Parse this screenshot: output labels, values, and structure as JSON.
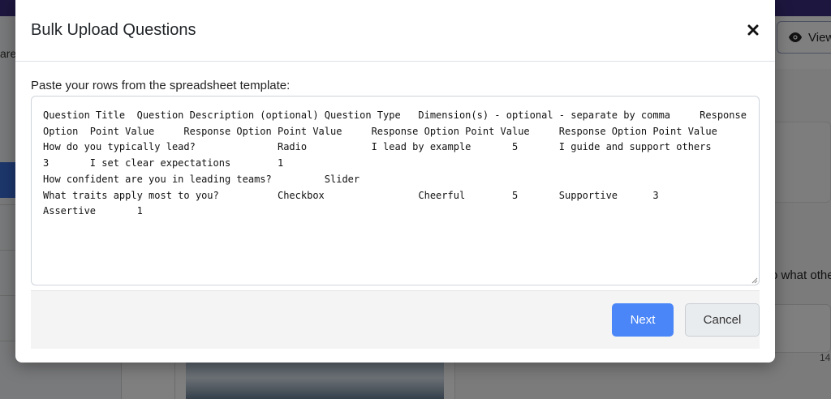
{
  "background": {
    "left_partial_text": "are",
    "view_button_label": "View",
    "right_partial_text": "o what othe",
    "right_partial_number": "14"
  },
  "modal": {
    "title": "Bulk Upload Questions",
    "close_icon": "close-icon",
    "field_label": "Paste your rows from the spreadsheet template:",
    "paste_value": "Question Title  Question Description (optional) Question Type   Dimension(s) - optional - separate by comma     Response Option  Point Value     Response Option Point Value     Response Option Point Value     Response Option Point Value\nHow do you typically lead?              Radio           I lead by example       5       I guide and support others      3       I set clear expectations        1\nHow confident are you in leading teams?         Slider\nWhat traits apply most to you?          Checkbox                Cheerful        5       Supportive      3       Assertive       1",
    "next_label": "Next",
    "cancel_label": "Cancel"
  },
  "colors": {
    "primary": "#4a86f7",
    "topbar": "#3b2d7d",
    "overlay": "rgba(0,0,0,0.5)"
  }
}
